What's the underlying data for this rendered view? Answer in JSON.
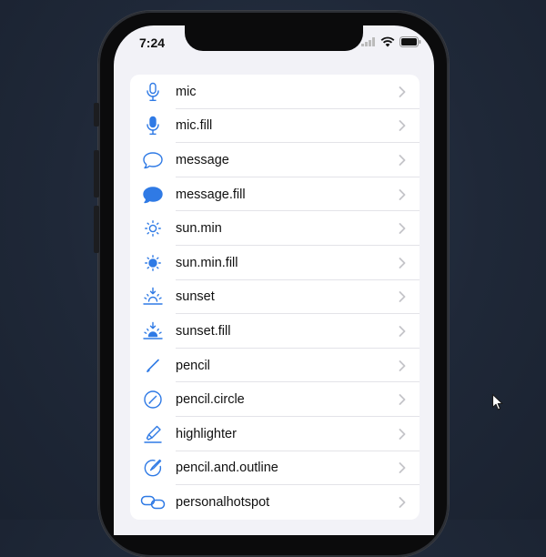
{
  "status_bar": {
    "time": "7:24"
  },
  "list": {
    "items": [
      {
        "label": "mic",
        "icon": "mic-icon"
      },
      {
        "label": "mic.fill",
        "icon": "mic-fill-icon"
      },
      {
        "label": "message",
        "icon": "message-icon"
      },
      {
        "label": "message.fill",
        "icon": "message-fill-icon"
      },
      {
        "label": "sun.min",
        "icon": "sun-min-icon"
      },
      {
        "label": "sun.min.fill",
        "icon": "sun-min-fill-icon"
      },
      {
        "label": "sunset",
        "icon": "sunset-icon"
      },
      {
        "label": "sunset.fill",
        "icon": "sunset-fill-icon"
      },
      {
        "label": "pencil",
        "icon": "pencil-icon"
      },
      {
        "label": "pencil.circle",
        "icon": "pencil-circle-icon"
      },
      {
        "label": "highlighter",
        "icon": "highlighter-icon"
      },
      {
        "label": "pencil.and.outline",
        "icon": "pencil-and-outline-icon"
      },
      {
        "label": "personalhotspot",
        "icon": "personalhotspot-icon"
      }
    ]
  },
  "colors": {
    "accent": "#2f7ae5",
    "chevron": "#c4c4c9"
  }
}
